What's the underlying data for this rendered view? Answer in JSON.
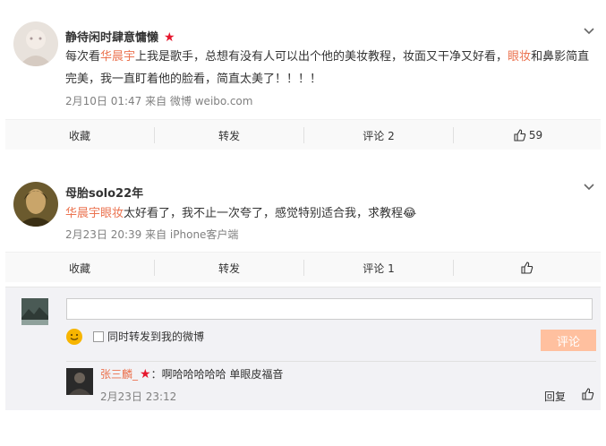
{
  "posts": [
    {
      "username": "静待闲时肆意慵懒",
      "content_parts": [
        "每次看",
        "华晨宇",
        "上我是歌手，总想有没有人可以出个他的美妆教程，妆面又干净又好看，",
        "眼妆",
        "和鼻影简直完美，我一直盯着他的脸看，简直太美了！！！！"
      ],
      "meta": "2月10日 01:47 来自 微博 weibo.com",
      "actions": {
        "collect": "收藏",
        "forward": "转发",
        "comment": "评论 2",
        "like": "59"
      }
    },
    {
      "username": "母胎solo22年",
      "content_parts": [
        "华晨宇眼妆",
        "太好看了，我不止一次夸了，感觉特别适合我，求教程"
      ],
      "emoji": "😂",
      "meta": "2月23日 20:39 来自 iPhone客户端",
      "actions": {
        "collect": "收藏",
        "forward": "转发",
        "comment": "评论 1",
        "like": ""
      }
    }
  ],
  "comment_box": {
    "input_value": "",
    "checkbox_label": "同时转发到我的微博",
    "submit_label": "评论"
  },
  "reply": {
    "user": "张三麟_",
    "text": "：啊哈哈哈哈哈 单眼皮福音",
    "time": "2月23日 23:12",
    "reply_label": "回复"
  },
  "colors": {
    "highlight": "#eb7350",
    "star": "#e6162d",
    "submit": "#ffc09f"
  },
  "icons": [
    "chevron-down-icon",
    "star-icon",
    "thumbs-up-icon",
    "smiley-icon"
  ]
}
